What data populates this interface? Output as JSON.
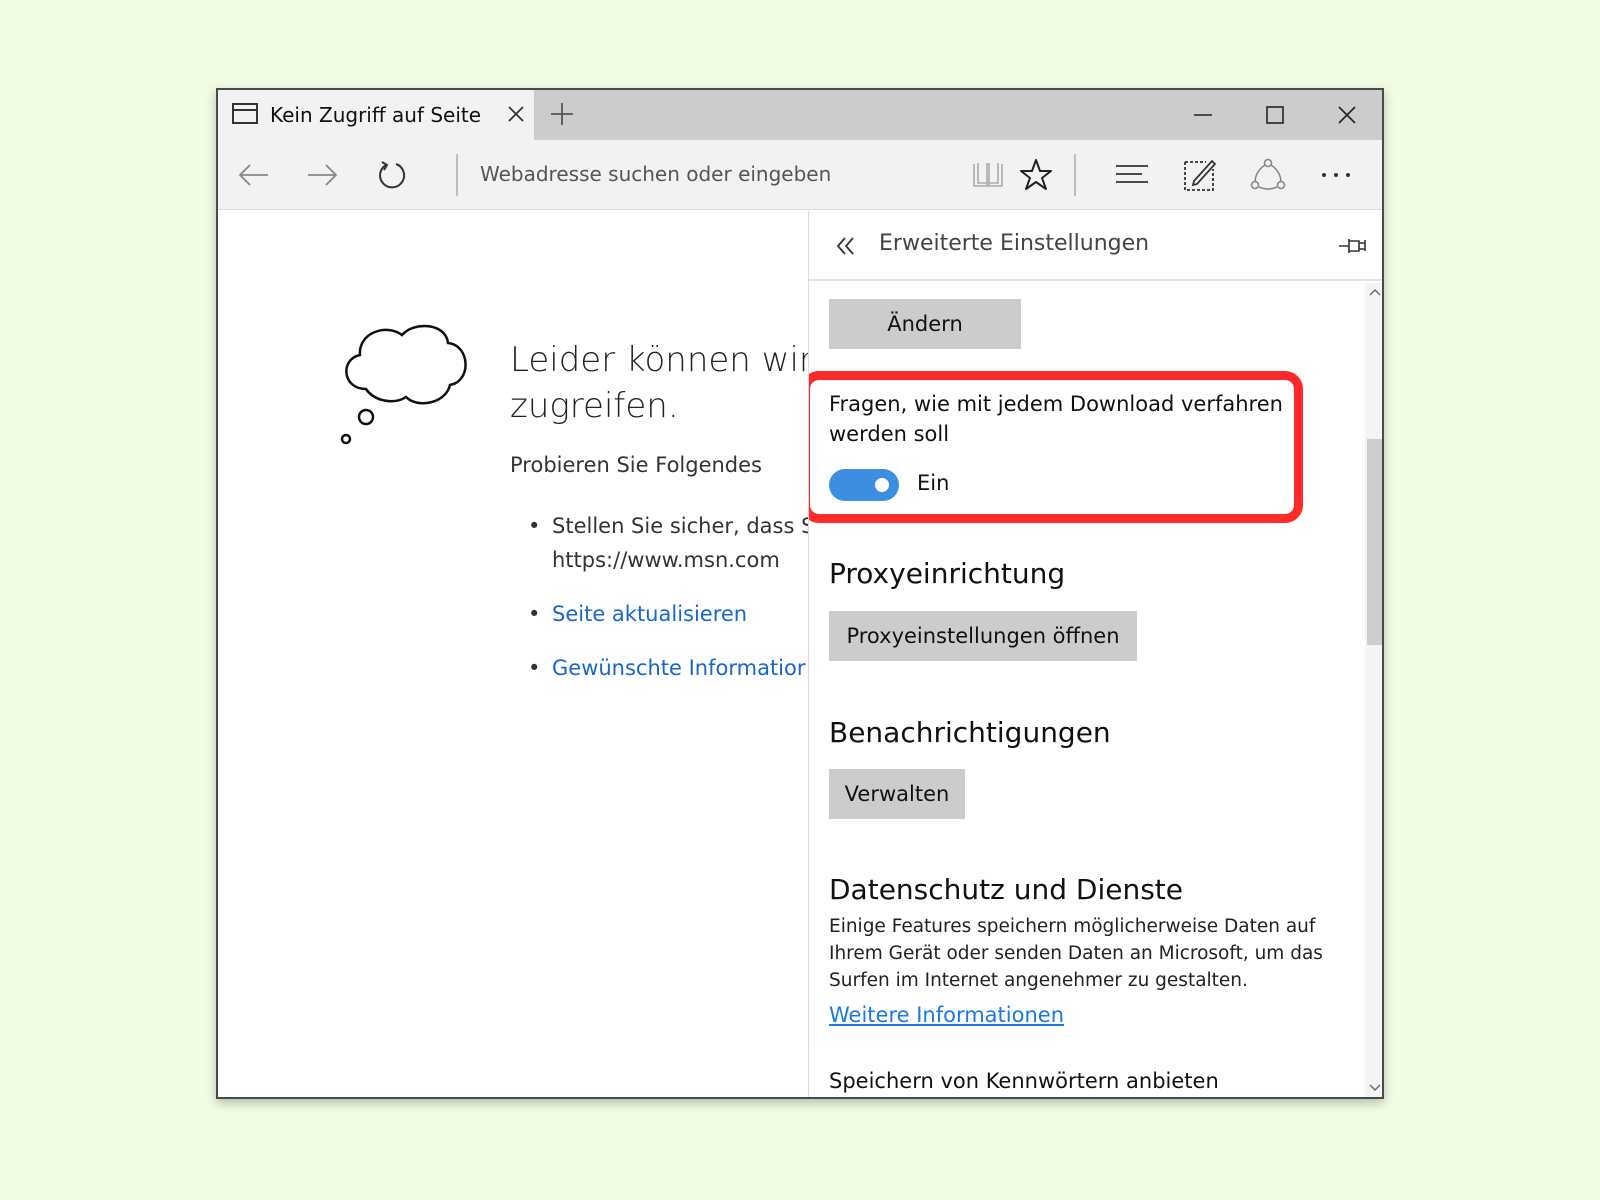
{
  "tab": {
    "title": "Kein Zugriff auf Seite"
  },
  "addressbar": {
    "placeholder": "Webadresse suchen oder eingeben"
  },
  "page": {
    "title_line1": "Leider können wir",
    "title_line2": "zugreifen.",
    "subtitle": "Probieren Sie Folgendes",
    "bullet1_line1": "Stellen Sie sicher, dass S",
    "bullet1_line2": "https://www.msn.com",
    "bullet2": "Seite aktualisieren",
    "bullet3": "Gewünschte Informatior"
  },
  "panel": {
    "title": "Erweiterte Einstellungen",
    "change_button": "Ändern",
    "ask_download_label": "Fragen, wie mit jedem Download verfahren werden soll",
    "ask_download_state": "Ein",
    "ask_download_on": true,
    "proxy_heading": "Proxyeinrichtung",
    "proxy_button": "Proxyeinstellungen öffnen",
    "notifications_heading": "Benachrichtigungen",
    "notifications_button": "Verwalten",
    "privacy_heading": "Datenschutz und Dienste",
    "privacy_description": "Einige Features speichern möglicherweise Daten auf Ihrem Gerät oder senden Daten an Microsoft, um das Surfen im Internet angenehmer zu gestalten.",
    "privacy_link": "Weitere Informationen",
    "password_label": "Speichern von Kennwörtern anbieten"
  },
  "colors": {
    "accent": "#3d8ee0",
    "highlight": "#ff2a2a",
    "link": "#1a66c9",
    "background": "#f0fde4"
  }
}
